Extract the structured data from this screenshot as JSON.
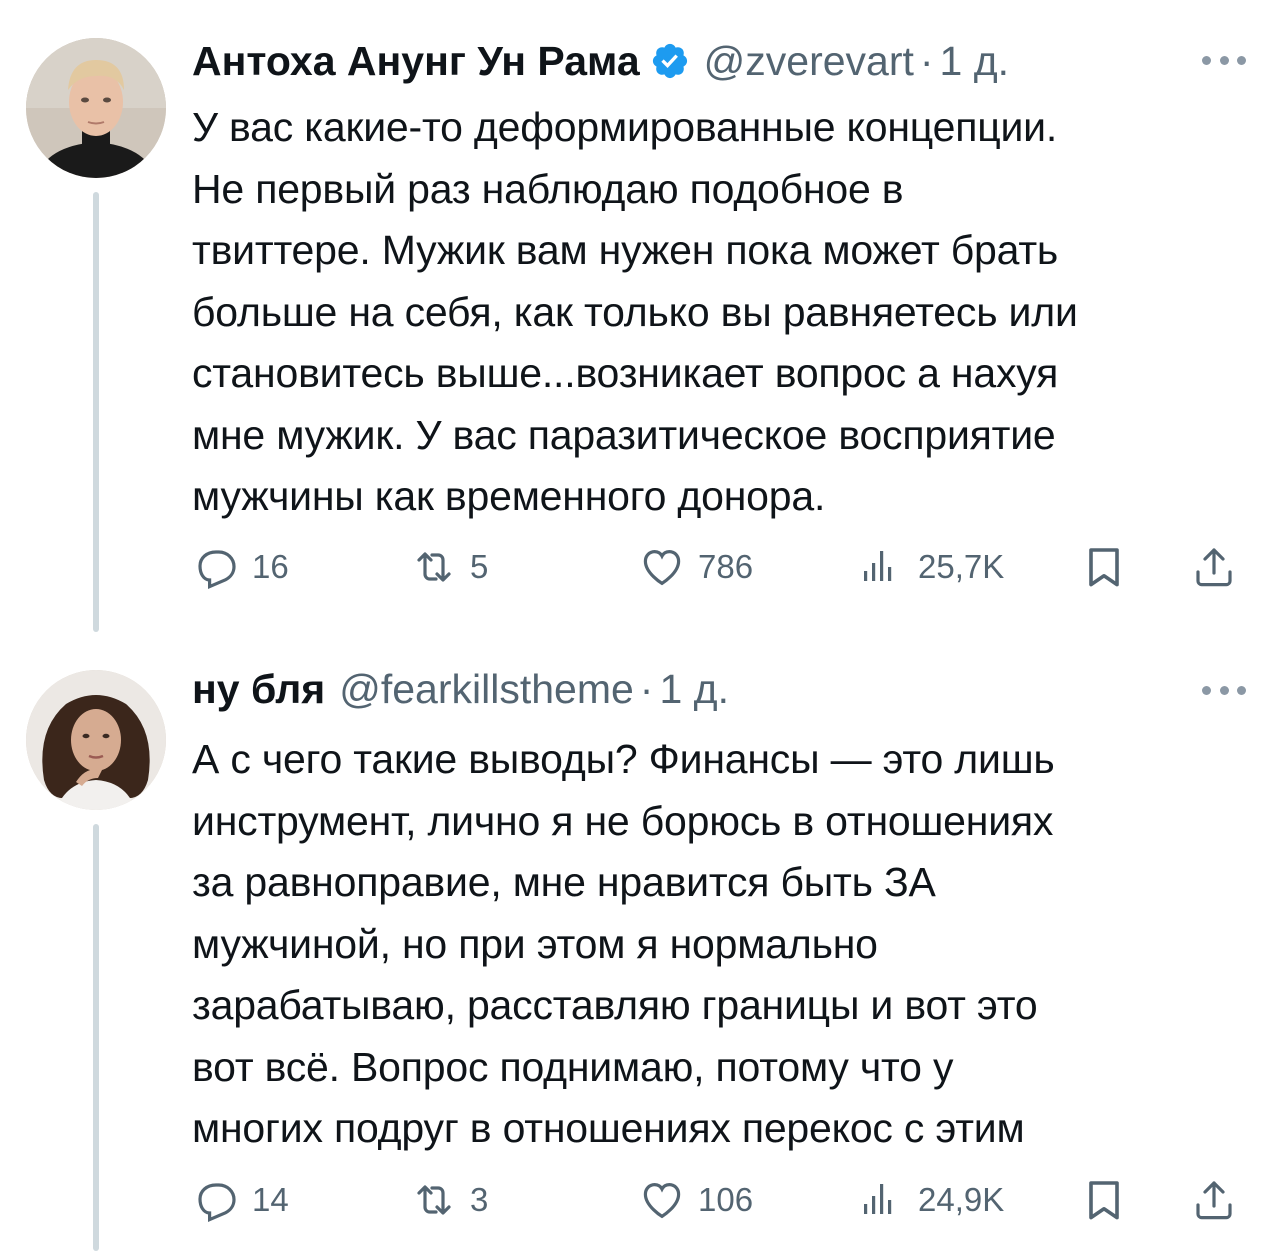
{
  "tweets": [
    {
      "author": {
        "display_name": "Антоха Анунг Ун Рама",
        "verified": true,
        "handle": "@zverevart",
        "separator": "·",
        "time": "1 д."
      },
      "avatar_icon": "avatar-man-icon",
      "text_lines": [
        "У вас какие-то деформированные концепции.",
        "Не первый раз наблюдаю подобное в",
        "твиттере. Мужик вам нужен пока может брать",
        "больше на себя, как только вы равняетесь или",
        "становитесь выше...возникает вопрос а нахуя",
        "мне мужик. У вас паразитическое восприятие",
        "мужчины как временного донора."
      ],
      "stats": {
        "replies": "16",
        "retweets": "5",
        "likes": "786",
        "views": "25,7K"
      }
    },
    {
      "author": {
        "display_name": "ну бля",
        "verified": false,
        "handle": "@fearkillstheme",
        "separator": "·",
        "time": "1 д."
      },
      "avatar_icon": "avatar-woman-icon",
      "text_lines": [
        "А с чего такие выводы? Финансы — это лишь",
        "инструмент, лично я не борюсь в отношениях",
        "за равноправие, мне нравится быть ЗА",
        "мужчиной, но при этом я нормально",
        "зарабатываю, расставляю границы и вот это",
        "вот всё. Вопрос поднимаю, потому что у",
        "многих подруг в отношениях перекос с этим"
      ],
      "stats": {
        "replies": "14",
        "retweets": "3",
        "likes": "106",
        "views": "24,9K"
      }
    }
  ],
  "colors": {
    "text_primary": "#0f1419",
    "text_secondary": "#536471",
    "verified_blue": "#1d9bf0",
    "thread_line": "#cfd9de"
  }
}
